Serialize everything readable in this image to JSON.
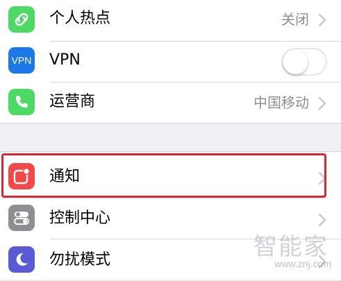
{
  "colors": {
    "hotspot_icon": "#4cd964",
    "vpn_icon": "#1b78e6",
    "carrier_icon": "#4cd964",
    "notifications_icon": "#f24848",
    "control_center_icon": "#8e8e93",
    "dnd_icon": "#5b5ad6",
    "highlight": "#e0242d"
  },
  "group1": {
    "items": [
      {
        "label": "个人热点",
        "value": "关闭",
        "icon": "link-icon"
      },
      {
        "label": "VPN",
        "icon_text": "VPN",
        "toggle_on": false,
        "icon": "vpn-icon"
      },
      {
        "label": "运营商",
        "value": "中国移动",
        "icon": "phone-icon"
      }
    ]
  },
  "group2": {
    "items": [
      {
        "label": "通知",
        "icon": "notifications-icon",
        "highlighted": true
      },
      {
        "label": "控制中心",
        "icon": "control-center-icon"
      },
      {
        "label": "勿扰模式",
        "icon": "moon-icon"
      }
    ]
  },
  "watermark": {
    "title": "智能家",
    "url": "www.znj.com"
  }
}
